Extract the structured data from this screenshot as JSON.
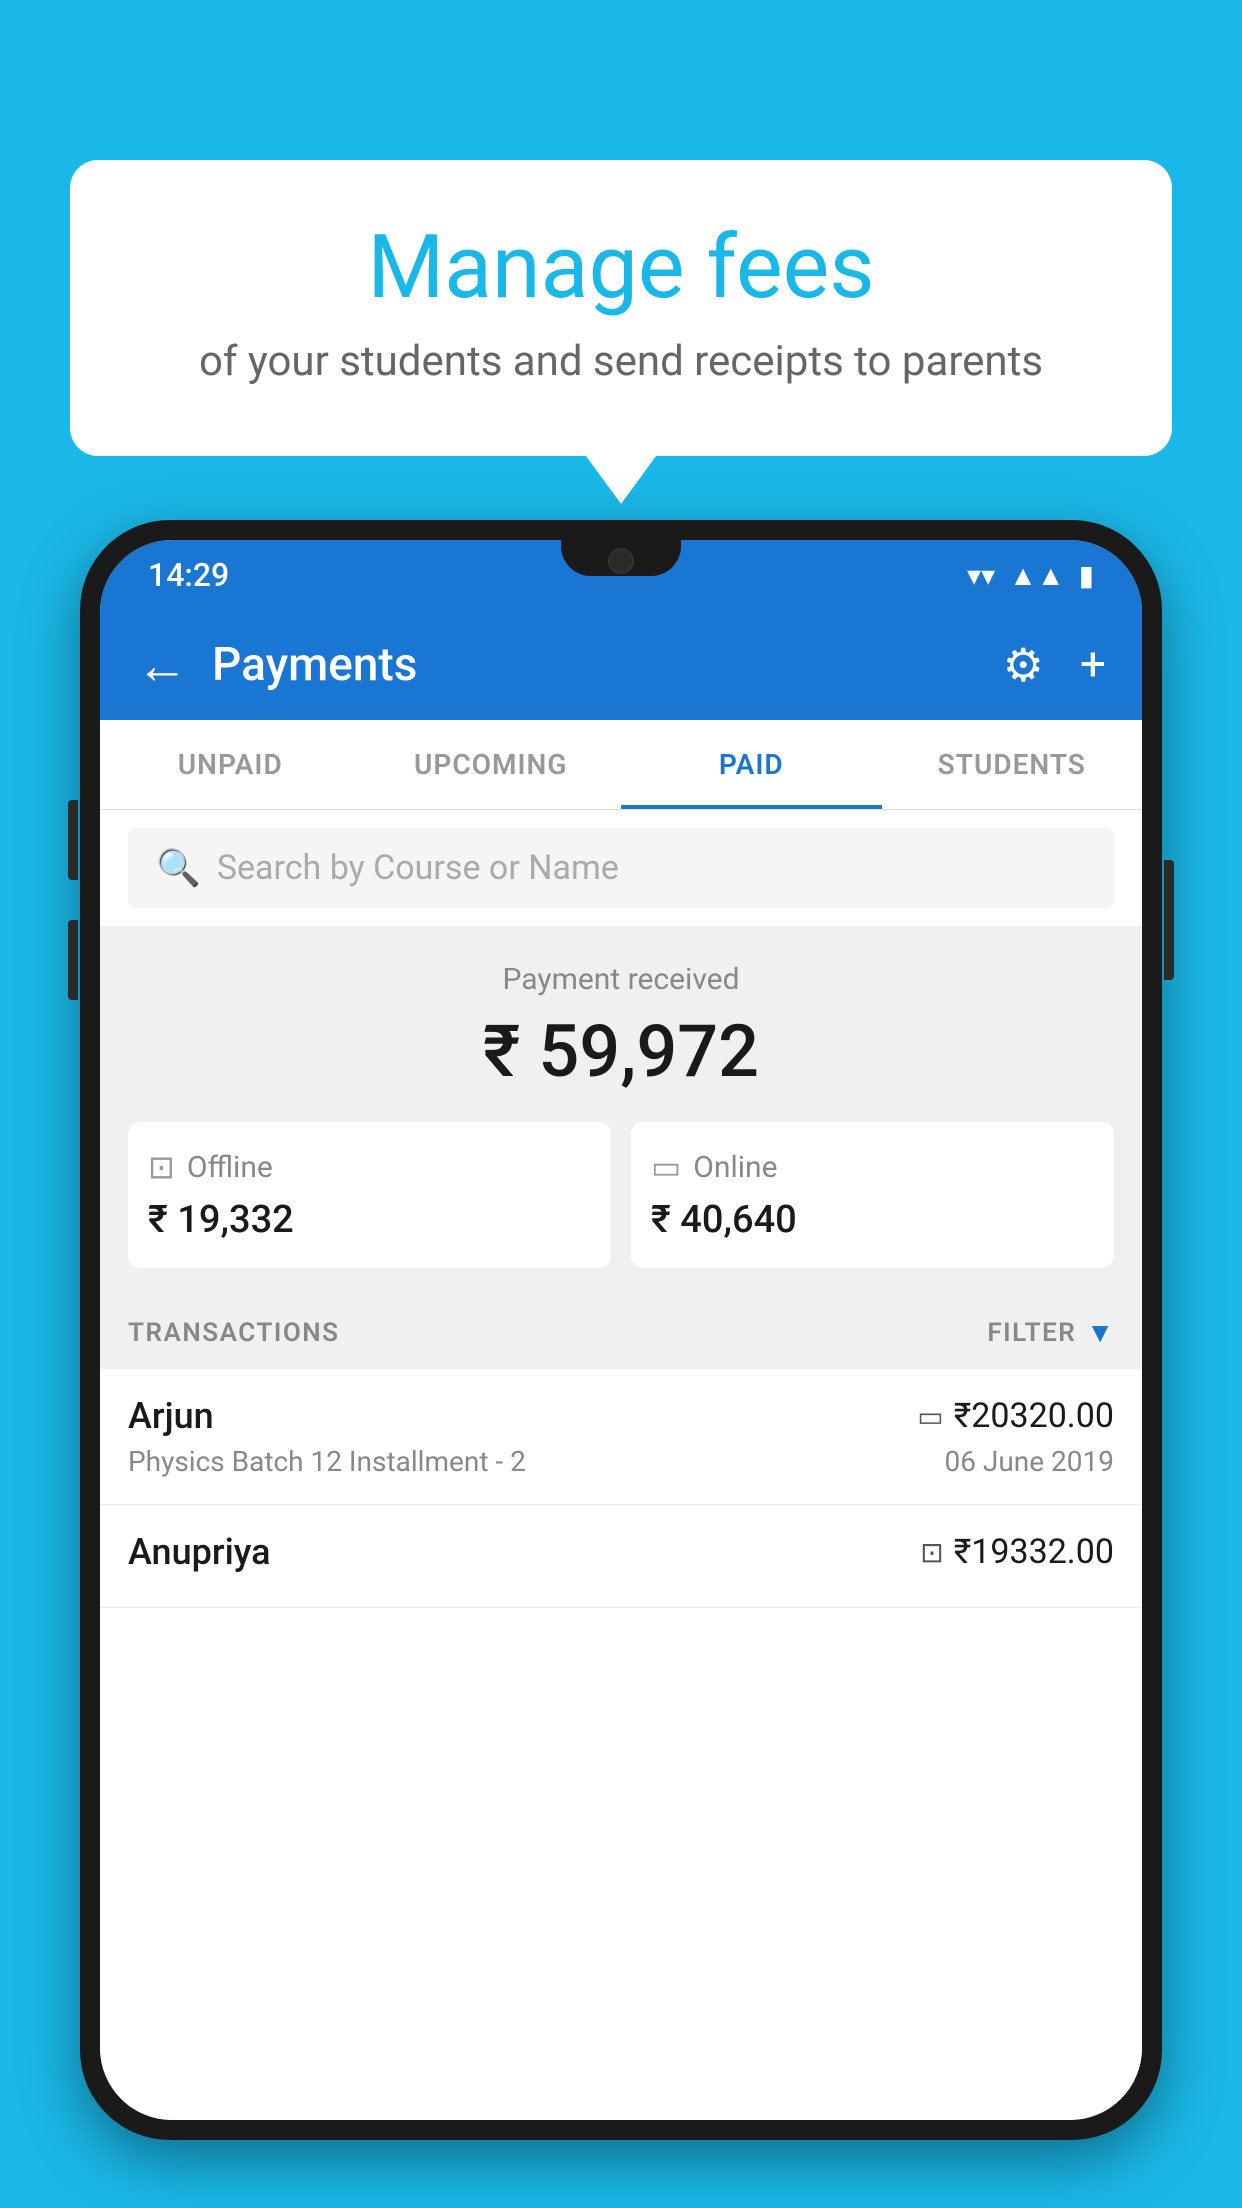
{
  "background_color": "#1ab8e8",
  "bubble": {
    "title": "Manage fees",
    "subtitle": "of your students and send receipts to parents"
  },
  "status_bar": {
    "time": "14:29",
    "wifi": "▼",
    "signal": "▲",
    "battery": "▮"
  },
  "app_bar": {
    "title": "Payments",
    "back_label": "←",
    "gear_label": "⚙",
    "add_label": "+"
  },
  "tabs": [
    {
      "label": "UNPAID",
      "active": false
    },
    {
      "label": "UPCOMING",
      "active": false
    },
    {
      "label": "PAID",
      "active": true
    },
    {
      "label": "STUDENTS",
      "active": false
    }
  ],
  "search": {
    "placeholder": "Search by Course or Name"
  },
  "payment_summary": {
    "label": "Payment received",
    "total_amount": "₹ 59,972",
    "offline": {
      "label": "Offline",
      "amount": "₹ 19,332"
    },
    "online": {
      "label": "Online",
      "amount": "₹ 40,640"
    }
  },
  "transactions": {
    "section_label": "TRANSACTIONS",
    "filter_label": "FILTER",
    "rows": [
      {
        "name": "Arjun",
        "description": "Physics Batch 12 Installment - 2",
        "amount": "₹20320.00",
        "date": "06 June 2019",
        "payment_type": "card"
      },
      {
        "name": "Anupriya",
        "description": "",
        "amount": "₹19332.00",
        "date": "",
        "payment_type": "cash"
      }
    ]
  }
}
